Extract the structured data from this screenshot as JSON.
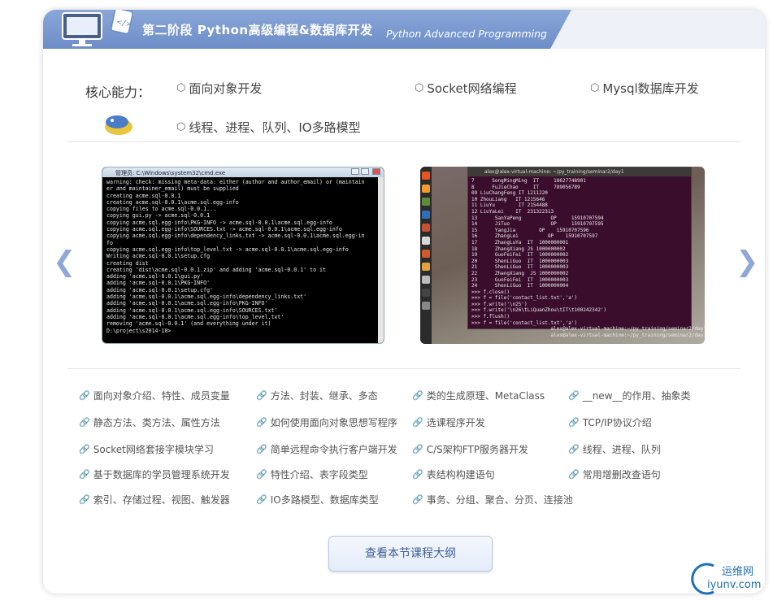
{
  "header": {
    "title": "第二阶段  Python高级编程&数据库开发",
    "subtitle": "Python Advanced Programming"
  },
  "abilities": {
    "label": "核心能力：",
    "items": [
      "面向对象开发",
      "Socket网络编程",
      "Mysql数据库开发",
      "线程、进程、队列、IO多路模型"
    ]
  },
  "screenshots": {
    "left": {
      "window_title": "管理员: C:\\Windows\\system32\\cmd.exe",
      "lines": [
        "warning: check: missing meta-data: either (author and author_email) or (maintain",
        "er and maintainer_email) must be supplied",
        "",
        "creating acme.sql-0.0.1",
        "creating acme.sql-0.0.1\\acme.sql.egg-info",
        "copying files to acme.sql-0.0.1...",
        "copying gui.py -> acme.sql-0.0.1",
        "copying acme.sql.egg-info\\PKG-INFO -> acme.sql-0.0.1\\acme.sql.egg-info",
        "copying acme.sql.egg-info\\SOURCES.txt -> acme.sql-0.0.1\\acme.sql.egg-info",
        "copying acme.sql.egg-info\\dependency_links.txt -> acme.sql-0.0.1\\acme.sql.egg-in",
        "fo",
        "copying acme.sql.egg-info\\top_level.txt -> acme.sql-0.0.1\\acme.sql.egg-info",
        "Writing acme.sql-0.0.1\\setup.cfg",
        "creating dist",
        "creating 'dist\\acme.sql-0.0.1.zip' and adding 'acme.sql-0.0.1' to it",
        "adding 'acme.sql-0.0.1\\gui.py'",
        "adding 'acme.sql-0.0.1\\PKG-INFO'",
        "adding 'acme.sql-0.0.1\\setup.cfg'",
        "adding 'acme.sql-0.0.1\\acme.sql.egg-info\\dependency_links.txt'",
        "adding 'acme.sql-0.0.1\\acme.sql.egg-info\\PKG-INFO'",
        "adding 'acme.sql-0.0.1\\acme.sql.egg-info\\SOURCES.txt'",
        "adding 'acme.sql-0.0.1\\acme.sql.egg-info\\top_level.txt'",
        "removing 'acme.sql-0.0.1' (and everything under it)",
        "",
        "D:\\project\\s2014-10>"
      ]
    },
    "right": {
      "window_title": "alex@alex-virtual-machine: ~/py_training/seminar2/day1",
      "lines": [
        "7      SongMingMing  IT     18627748901",
        "8      FuJieChao     IT     789056789",
        "09 LiuChangFeng IT 1211220",
        "10 ZhouLiang   IT 1215646",
        "11 LiuYu        IT 2154488",
        "12 LiuYaLei    IT  231322313",
        "13      SanYaPeng          OP     15910707594",
        "14      JiTuo              OP     15910707595",
        "15      YangJia        OP    15910707596",
        "16      ZhangLei          OP    15910707597",
        "17      ZhangLuYa  IT  1000000001",
        "18      ZhangXiang JS 1000000002",
        "19      GuoFeiFei  IT  1000000002",
        "20      ShenLiGuo  IT  1000000003",
        "21      ShenLiGuo  IT  1000000003",
        "22      ZhangXiang  JS 1000000002",
        "23      GuoFeiFei  IT  1000000003",
        "24      ShenLiGuo  IT  1000000004",
        ">>> f.close()",
        ">>> f = file('contact_list.txt','a')",
        ">>> f.write('\\n25')",
        ">>> f.write('\\n26\\tLiQuanZhou\\tIT\\t100242342')",
        ">>> f.flush()",
        ">>> f = file('contact_list.txt','a')",
        "                           alex@alex-virtual-machine:~/py_training/seminar2/day1$",
        "                           alex@alex-virtual-machine:~/py_training/seminar2/day1$"
      ]
    }
  },
  "topics": [
    "面向对象介绍、特性、成员变量",
    "方法、封装、继承、多态",
    "类的生成原理、MetaClass",
    "__new__的作用、抽象类",
    "静态方法、类方法、属性方法",
    "如何使用面向对象思想写程序",
    "选课程序开发",
    "TCP/IP协议介绍",
    "Socket网络套接字模块学习",
    "简单远程命令执行客户端开发",
    "C/S架构FTP服务器开发",
    "线程、进程、队列",
    "基于数据库的学员管理系统开发",
    "特性介绍、表字段类型",
    "表结构构建语句",
    "常用增删改查语句",
    "索引、存储过程、视图、触发器",
    "IO多路模型、数据库类型",
    "事务、分组、聚合、分页、连接池"
  ],
  "cta": {
    "label": "查看本节课程大纲"
  },
  "watermark": {
    "cn": "运维网",
    "en": "iyunv.com"
  },
  "icons": {
    "hex": "⬡",
    "link": "🔗",
    "prev": "❮",
    "next": "❯"
  }
}
